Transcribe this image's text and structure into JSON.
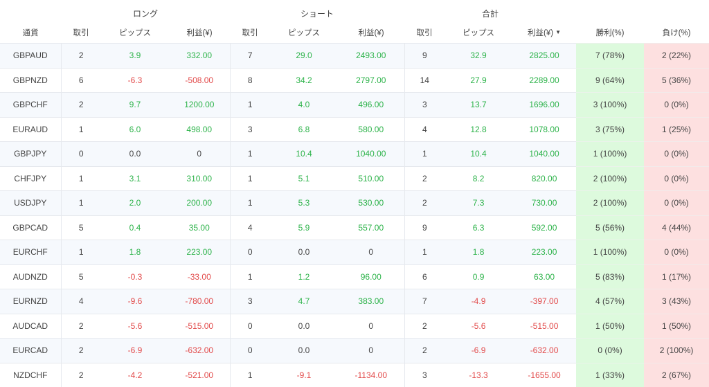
{
  "groups": {
    "long": "ロング",
    "short": "ショート",
    "total": "合計"
  },
  "columns": {
    "currency": "通貨",
    "trades": "取引",
    "pips": "ピップス",
    "profit": "利益(¥)",
    "win": "勝利(%)",
    "loss": "負け(%)"
  },
  "sort_icon": "triangle-down-icon",
  "colors": {
    "positive": "#2db34a",
    "negative": "#e24a4a",
    "win_bg": "#ddfadd",
    "loss_bg": "#fde0e0"
  },
  "rows": [
    {
      "currency": "GBPAUD",
      "long_trades": "2",
      "long_pips": "3.9",
      "long_profit": "332.00",
      "short_trades": "7",
      "short_pips": "29.0",
      "short_profit": "2493.00",
      "total_trades": "9",
      "total_pips": "32.9",
      "total_profit": "2825.00",
      "win": "7 (78%)",
      "loss": "2 (22%)"
    },
    {
      "currency": "GBPNZD",
      "long_trades": "6",
      "long_pips": "-6.3",
      "long_profit": "-508.00",
      "short_trades": "8",
      "short_pips": "34.2",
      "short_profit": "2797.00",
      "total_trades": "14",
      "total_pips": "27.9",
      "total_profit": "2289.00",
      "win": "9 (64%)",
      "loss": "5 (36%)"
    },
    {
      "currency": "GBPCHF",
      "long_trades": "2",
      "long_pips": "9.7",
      "long_profit": "1200.00",
      "short_trades": "1",
      "short_pips": "4.0",
      "short_profit": "496.00",
      "total_trades": "3",
      "total_pips": "13.7",
      "total_profit": "1696.00",
      "win": "3 (100%)",
      "loss": "0 (0%)"
    },
    {
      "currency": "EURAUD",
      "long_trades": "1",
      "long_pips": "6.0",
      "long_profit": "498.00",
      "short_trades": "3",
      "short_pips": "6.8",
      "short_profit": "580.00",
      "total_trades": "4",
      "total_pips": "12.8",
      "total_profit": "1078.00",
      "win": "3 (75%)",
      "loss": "1 (25%)"
    },
    {
      "currency": "GBPJPY",
      "long_trades": "0",
      "long_pips": "0.0",
      "long_profit": "0",
      "short_trades": "1",
      "short_pips": "10.4",
      "short_profit": "1040.00",
      "total_trades": "1",
      "total_pips": "10.4",
      "total_profit": "1040.00",
      "win": "1 (100%)",
      "loss": "0 (0%)"
    },
    {
      "currency": "CHFJPY",
      "long_trades": "1",
      "long_pips": "3.1",
      "long_profit": "310.00",
      "short_trades": "1",
      "short_pips": "5.1",
      "short_profit": "510.00",
      "total_trades": "2",
      "total_pips": "8.2",
      "total_profit": "820.00",
      "win": "2 (100%)",
      "loss": "0 (0%)"
    },
    {
      "currency": "USDJPY",
      "long_trades": "1",
      "long_pips": "2.0",
      "long_profit": "200.00",
      "short_trades": "1",
      "short_pips": "5.3",
      "short_profit": "530.00",
      "total_trades": "2",
      "total_pips": "7.3",
      "total_profit": "730.00",
      "win": "2 (100%)",
      "loss": "0 (0%)"
    },
    {
      "currency": "GBPCAD",
      "long_trades": "5",
      "long_pips": "0.4",
      "long_profit": "35.00",
      "short_trades": "4",
      "short_pips": "5.9",
      "short_profit": "557.00",
      "total_trades": "9",
      "total_pips": "6.3",
      "total_profit": "592.00",
      "win": "5 (56%)",
      "loss": "4 (44%)"
    },
    {
      "currency": "EURCHF",
      "long_trades": "1",
      "long_pips": "1.8",
      "long_profit": "223.00",
      "short_trades": "0",
      "short_pips": "0.0",
      "short_profit": "0",
      "total_trades": "1",
      "total_pips": "1.8",
      "total_profit": "223.00",
      "win": "1 (100%)",
      "loss": "0 (0%)"
    },
    {
      "currency": "AUDNZD",
      "long_trades": "5",
      "long_pips": "-0.3",
      "long_profit": "-33.00",
      "short_trades": "1",
      "short_pips": "1.2",
      "short_profit": "96.00",
      "total_trades": "6",
      "total_pips": "0.9",
      "total_profit": "63.00",
      "win": "5 (83%)",
      "loss": "1 (17%)"
    },
    {
      "currency": "EURNZD",
      "long_trades": "4",
      "long_pips": "-9.6",
      "long_profit": "-780.00",
      "short_trades": "3",
      "short_pips": "4.7",
      "short_profit": "383.00",
      "total_trades": "7",
      "total_pips": "-4.9",
      "total_profit": "-397.00",
      "win": "4 (57%)",
      "loss": "3 (43%)"
    },
    {
      "currency": "AUDCAD",
      "long_trades": "2",
      "long_pips": "-5.6",
      "long_profit": "-515.00",
      "short_trades": "0",
      "short_pips": "0.0",
      "short_profit": "0",
      "total_trades": "2",
      "total_pips": "-5.6",
      "total_profit": "-515.00",
      "win": "1 (50%)",
      "loss": "1 (50%)"
    },
    {
      "currency": "EURCAD",
      "long_trades": "2",
      "long_pips": "-6.9",
      "long_profit": "-632.00",
      "short_trades": "0",
      "short_pips": "0.0",
      "short_profit": "0",
      "total_trades": "2",
      "total_pips": "-6.9",
      "total_profit": "-632.00",
      "win": "0 (0%)",
      "loss": "2 (100%)"
    },
    {
      "currency": "NZDCHF",
      "long_trades": "2",
      "long_pips": "-4.2",
      "long_profit": "-521.00",
      "short_trades": "1",
      "short_pips": "-9.1",
      "short_profit": "-1134.00",
      "total_trades": "3",
      "total_pips": "-13.3",
      "total_profit": "-1655.00",
      "win": "1 (33%)",
      "loss": "2 (67%)"
    }
  ]
}
